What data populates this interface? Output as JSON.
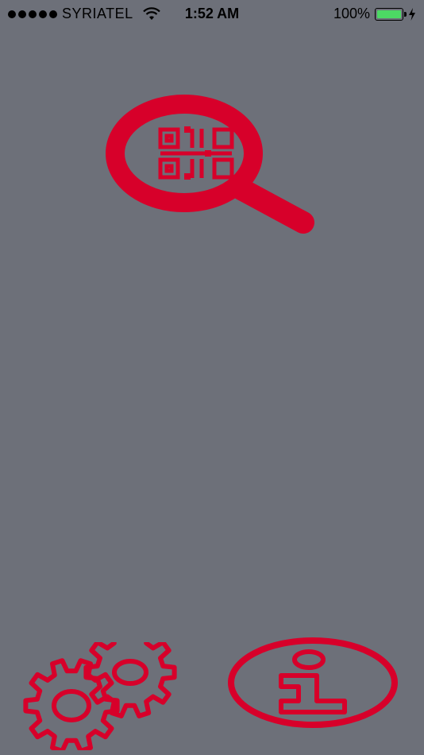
{
  "status_bar": {
    "carrier": "SYRIATEL",
    "time": "1:52 AM",
    "battery_percent": "100%",
    "battery_level": 1.0,
    "signal_bars": 5,
    "icons": [
      "signal-dots-icon",
      "wifi-icon",
      "battery-icon",
      "charging-bolt-icon"
    ]
  },
  "main": {
    "scan_button": {
      "icon": "qr-magnifier-icon"
    },
    "settings_button": {
      "icon": "gears-icon"
    },
    "info_button": {
      "icon": "info-icon"
    }
  },
  "colors": {
    "background": "#6d7079",
    "accent": "#d7002a",
    "battery": "#4cd964"
  }
}
